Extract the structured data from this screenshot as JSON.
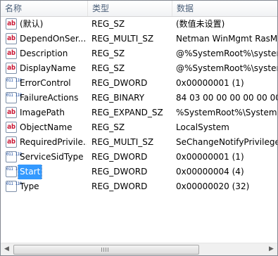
{
  "columns": {
    "name": "名称",
    "type": "类型",
    "data": "数据"
  },
  "rows": [
    {
      "icon": "string-value-icon",
      "icon_glyph": "ab",
      "name": "(默认)",
      "type": "REG_SZ",
      "data": "(数值未设置)"
    },
    {
      "icon": "string-value-icon",
      "icon_glyph": "ab",
      "name": "DependOnSer...",
      "type": "REG_MULTI_SZ",
      "data": "Netman WinMgmt RasM"
    },
    {
      "icon": "string-value-icon",
      "icon_glyph": "ab",
      "name": "Description",
      "type": "REG_SZ",
      "data": "@%SystemRoot%\\system"
    },
    {
      "icon": "string-value-icon",
      "icon_glyph": "ab",
      "name": "DisplayName",
      "type": "REG_SZ",
      "data": "@%SystemRoot%\\system"
    },
    {
      "icon": "binary-value-icon",
      "icon_glyph": "011 110",
      "name": "ErrorControl",
      "type": "REG_DWORD",
      "data": "0x00000001 (1)"
    },
    {
      "icon": "binary-value-icon",
      "icon_glyph": "011 110",
      "name": "FailureActions",
      "type": "REG_BINARY",
      "data": "84 03 00 00 00 00 00 00"
    },
    {
      "icon": "string-value-icon",
      "icon_glyph": "ab",
      "name": "ImagePath",
      "type": "REG_EXPAND_SZ",
      "data": "%SystemRoot%\\System3"
    },
    {
      "icon": "string-value-icon",
      "icon_glyph": "ab",
      "name": "ObjectName",
      "type": "REG_SZ",
      "data": "LocalSystem"
    },
    {
      "icon": "string-value-icon",
      "icon_glyph": "ab",
      "name": "RequiredPrivile...",
      "type": "REG_MULTI_SZ",
      "data": "SeChangeNotifyPrivilege"
    },
    {
      "icon": "binary-value-icon",
      "icon_glyph": "011 110",
      "name": "ServiceSidType",
      "type": "REG_DWORD",
      "data": "0x00000001 (1)"
    },
    {
      "icon": "binary-value-icon",
      "icon_glyph": "011 110",
      "name": "Start",
      "type": "REG_DWORD",
      "data": "0x00000004 (4)",
      "selected": true
    },
    {
      "icon": "binary-value-icon",
      "icon_glyph": "011 110",
      "name": "Type",
      "type": "REG_DWORD",
      "data": "0x00000020 (32)"
    }
  ],
  "scrollbar": {
    "left_arrow": "◀",
    "right_arrow": "▶"
  },
  "colors": {
    "selection": "#3399ff",
    "header_text": "#4c607a",
    "string_icon": "#c8102e",
    "binary_icon": "#1f4fa3"
  }
}
